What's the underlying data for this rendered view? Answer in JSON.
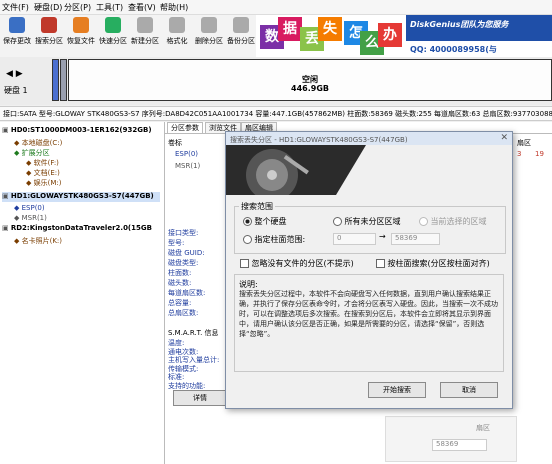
{
  "menu": [
    "文件(F)",
    "硬盘(D)",
    "分区(P)",
    "工具(T)",
    "查看(V)",
    "帮助(H)"
  ],
  "toolbar": [
    {
      "label": "保存更改",
      "icon": "save-icon",
      "color": "#3a6fc4"
    },
    {
      "label": "搜索分区",
      "icon": "search-icon",
      "color": "#c0392b"
    },
    {
      "label": "恢复文件",
      "icon": "recover-icon",
      "color": "#e67e22"
    },
    {
      "label": "快速分区",
      "icon": "quick-partition-icon",
      "color": "#27ae60"
    },
    {
      "label": "新建分区",
      "icon": "new-partition-icon",
      "color": "#aaaaaa"
    },
    {
      "label": "格式化",
      "icon": "format-icon",
      "color": "#aaaaaa"
    },
    {
      "label": "删除分区",
      "icon": "delete-icon",
      "color": "#aaaaaa"
    },
    {
      "label": "备份分区",
      "icon": "backup-icon",
      "color": "#aaaaaa"
    }
  ],
  "banner": {
    "chars": [
      {
        "c": "数",
        "color": "#7b2fa6"
      },
      {
        "c": "据",
        "color": "#d81b60"
      },
      {
        "c": "丢",
        "color": "#8bc34a"
      },
      {
        "c": "失",
        "color": "#f57c00"
      },
      {
        "c": "怎",
        "color": "#1e88e5"
      },
      {
        "c": "么",
        "color": "#43a047"
      },
      {
        "c": "办",
        "color": "#e53935"
      }
    ],
    "brand": "DiskGenius团队为您服务",
    "qq": "QQ: 4000089958(与"
  },
  "diskmap": {
    "disk_label": "硬盘 1",
    "partition_name": "空闲",
    "partition_size": "446.9GB"
  },
  "infoline": "接口:SATA  型号:GLOWAY STK480GS3-S7  序列号:DA8D42C051AA1001734  容量:447.1GB(457862MB)  柱面数:58369  磁头数:255  每道扇区数:63  总扇区数:937703088",
  "tree": [
    {
      "text": "HD0:ST1000DM003-1ER162(932GB)",
      "bold": true,
      "color": "#000"
    },
    {
      "text": "本地磁盘(C:)",
      "color": "#7a3d00"
    },
    {
      "text": "扩展分区",
      "color": "#1e7b1e"
    },
    {
      "text": "软件(F:)",
      "color": "#7a3d00"
    },
    {
      "text": "文档(E:)",
      "color": "#7a3d00"
    },
    {
      "text": "娱乐(M:)",
      "color": "#7a3d00"
    },
    {
      "text": "HD1:GLOWAYSTK480GS3-S7(447GB)",
      "bold": true,
      "color": "#000"
    },
    {
      "text": "ESP(0)",
      "color": "#1f3c9e"
    },
    {
      "text": "MSR(1)",
      "color": "#555"
    },
    {
      "text": "RD2:KingstonDataTraveler2.0(15GB",
      "bold": true,
      "color": "#000"
    },
    {
      "text": "名卡照片(K:)",
      "color": "#7a3d00"
    }
  ],
  "tabs": [
    "分区参数",
    "浏览文件",
    "扇区编辑"
  ],
  "part_list": {
    "header": "卷标",
    "rows": [
      "ESP(0)",
      "MSR(1)"
    ],
    "right_header": "扇区",
    "right_values": [
      "3",
      "19"
    ]
  },
  "disk_fields_1": [
    "接口类型:",
    "型号:",
    "磁盘 GUID:",
    "磁盘类型:"
  ],
  "disk_fields_2": [
    "柱面数:",
    "磁头数:",
    "每道扇区数:",
    "总容量:",
    "总扇区数:"
  ],
  "smart": {
    "title": "S.M.A.R.T. 信息",
    "fields": [
      "温度:",
      "通电次数:",
      "主机写入量总计:",
      "传输模式:",
      "标准:",
      "支持的功能:"
    ]
  },
  "details_button": "详情",
  "dialog": {
    "title": "搜索丢失分区 - HD1:GLOWAYSTK480GS3-S7(447GB)",
    "range_title": "搜索范围",
    "options": [
      "整个硬盘",
      "所有未分区区域",
      "当前选择的区域"
    ],
    "cyl_option": "指定柱面范围:",
    "cyl_from": "0",
    "cyl_to": "58369",
    "check1": "忽略没有文件的分区(不提示)",
    "check2": "按柱面搜索(分区按柱面对齐)",
    "desc_title": "说明:",
    "desc": "搜索丢失分区过程中，本软件不会向硬盘写入任何数据，直到用户确认搜索结果正确，并执行了保存分区表命令时，才会将分区表写入硬盘。因此，当搜索一次不成功时，可以在调整选项后多次搜索。在搜索到分区后，本软件会立即将其显示到界面中，请用户确认该分区是否正确，如果是所需要的分区，请选择“保留”，否则选择“忽略”。",
    "start": "开始搜索",
    "cancel": "取消"
  },
  "bottom_field": "58369",
  "bottom_label": "扇区"
}
